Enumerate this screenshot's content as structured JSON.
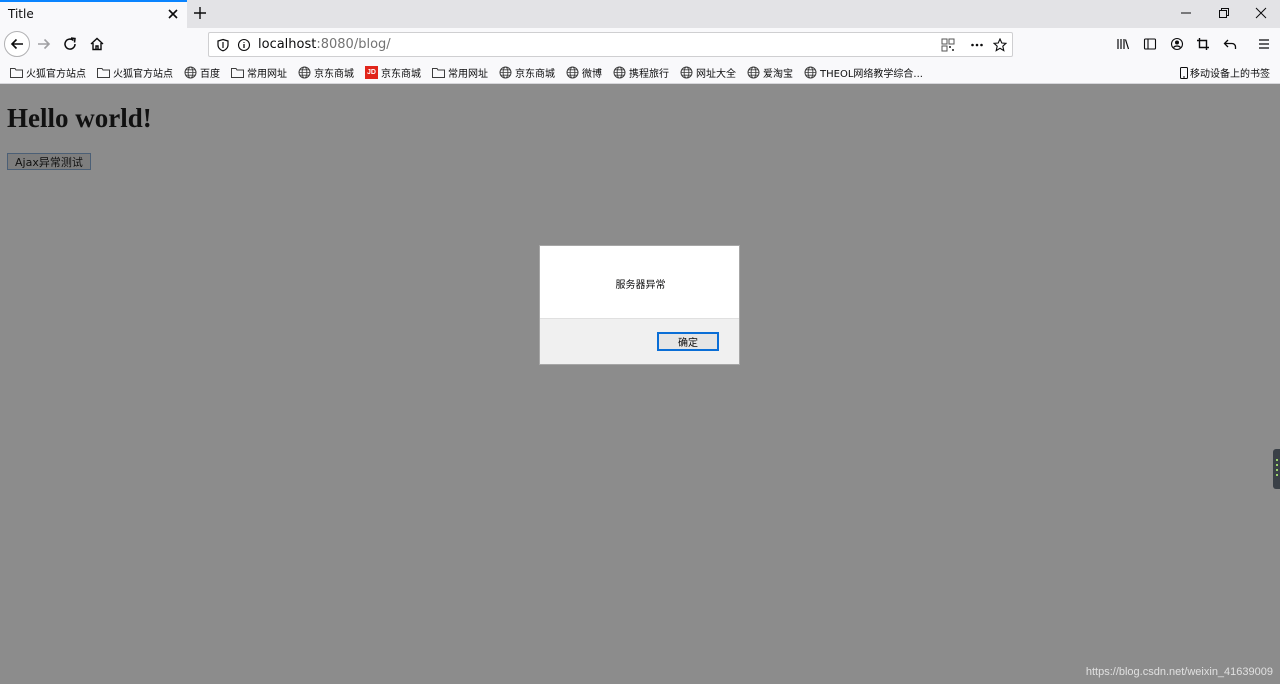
{
  "browser": {
    "tab": {
      "title": "Title"
    },
    "url": {
      "host": "localhost",
      "rest": ":8080/blog/"
    },
    "bookmarks": [
      {
        "label": "火狐官方站点",
        "icon": "folder-icon"
      },
      {
        "label": "火狐官方站点",
        "icon": "folder-icon"
      },
      {
        "label": "百度",
        "icon": "globe-icon"
      },
      {
        "label": "常用网址",
        "icon": "folder-icon"
      },
      {
        "label": "京东商城",
        "icon": "globe-icon"
      },
      {
        "label": "京东商城",
        "icon": "jd-icon",
        "badge": "JD"
      },
      {
        "label": "常用网址",
        "icon": "folder-icon"
      },
      {
        "label": "京东商城",
        "icon": "globe-icon"
      },
      {
        "label": "微博",
        "icon": "globe-icon"
      },
      {
        "label": "携程旅行",
        "icon": "globe-icon"
      },
      {
        "label": "网址大全",
        "icon": "globe-icon"
      },
      {
        "label": "爱淘宝",
        "icon": "globe-icon"
      },
      {
        "label": "THEOL网络教学综合...",
        "icon": "globe-icon"
      }
    ],
    "mobile_bookmarks": "移动设备上的书签"
  },
  "page": {
    "heading": "Hello world!",
    "button_label": "Ajax异常测试"
  },
  "dialog": {
    "message": "服务器异常",
    "ok_label": "确定"
  },
  "watermark": "https://blog.csdn.net/weixin_41639009",
  "colors": {
    "accent": "#0a84ff",
    "overlay": "#8c8c8c",
    "jd_red": "#e1251b"
  }
}
